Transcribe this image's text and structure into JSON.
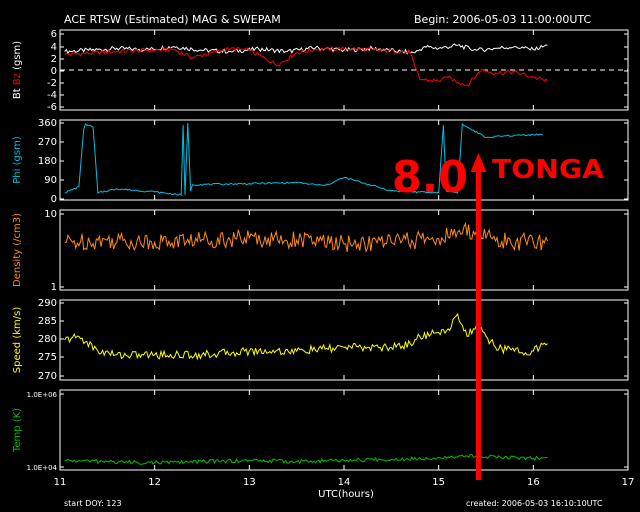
{
  "header": {
    "title": "ACE RTSW (Estimated) MAG & SWEPAM",
    "begin": "Begin: 2006-05-03 11:00:00UTC"
  },
  "footer": {
    "start_doy": "start DOY: 123",
    "created": "created: 2006-05-03 16:10:10UTC",
    "xlabel": "UTC(hours)"
  },
  "annotation": {
    "magnitude": "8.0",
    "place": "TONGA",
    "color": "#ff0000",
    "x_hour": 15.42
  },
  "colors": {
    "bt": "#ffffff",
    "bz": "#ff0000",
    "phi": "#00c0e0",
    "density": "#ff8c1a",
    "speed": "#ffff00",
    "temp": "#00c000"
  },
  "chart_data": {
    "type": "line",
    "xlim": [
      11,
      17
    ],
    "x_ticks": [
      "11",
      "12",
      "13",
      "14",
      "15",
      "16",
      "17"
    ],
    "panels": [
      {
        "name": "mag",
        "ylabel_parts": [
          "Bt",
          "Bz",
          "(gsm)"
        ],
        "ylim": [
          -6,
          6
        ],
        "ticks": [
          "6",
          "4",
          "2",
          "0",
          "-2",
          "-4",
          "-6"
        ],
        "zero_line": true,
        "series": [
          {
            "name": "Bt",
            "color": "#ffffff",
            "x": [
              11.05,
              11.3,
              11.6,
              11.9,
              12.2,
              12.5,
              12.8,
              13.1,
              13.4,
              13.7,
              14.0,
              14.3,
              14.6,
              14.75,
              14.85,
              15.0,
              15.2,
              15.4,
              15.6,
              15.8,
              16.0,
              16.15
            ],
            "y": [
              3.0,
              3.2,
              3.5,
              3.3,
              3.8,
              3.2,
              3.0,
              3.4,
              3.0,
              3.6,
              3.2,
              3.5,
              3.0,
              2.8,
              3.8,
              3.5,
              4.0,
              3.2,
              3.5,
              3.8,
              3.3,
              4.0
            ]
          },
          {
            "name": "Bz",
            "color": "#ff0000",
            "x": [
              11.05,
              11.3,
              11.6,
              11.9,
              12.2,
              12.4,
              12.6,
              12.8,
              13.0,
              13.3,
              13.5,
              13.7,
              14.0,
              14.3,
              14.6,
              14.7,
              14.75,
              14.8,
              15.0,
              15.1,
              15.3,
              15.45,
              15.6,
              15.8,
              16.0,
              16.15
            ],
            "y": [
              2.5,
              2.7,
              3.0,
              3.2,
              3.3,
              2.0,
              2.8,
              3.5,
              3.2,
              0.8,
              2.8,
              3.3,
              3.5,
              3.3,
              3.0,
              2.8,
              0.5,
              -1.5,
              -1.8,
              -1.2,
              -2.5,
              0.0,
              -0.5,
              -0.3,
              -1.2,
              -1.8
            ]
          }
        ]
      },
      {
        "name": "phi",
        "ylabel_parts": [
          "Phi",
          "(gsm)"
        ],
        "ylim": [
          0,
          360
        ],
        "ticks": [
          "360",
          "270",
          "180",
          "90",
          "0"
        ],
        "series": [
          {
            "name": "Phi",
            "color": "#00c0e0",
            "x": [
              11.05,
              11.2,
              11.25,
              11.27,
              11.35,
              11.4,
              11.6,
              12.0,
              12.28,
              12.3,
              12.32,
              12.35,
              12.38,
              12.4,
              13.0,
              13.5,
              13.8,
              14.0,
              14.5,
              14.9,
              15.0,
              15.05,
              15.08,
              15.2,
              15.25,
              15.3,
              15.5,
              15.8,
              16.1
            ],
            "y": [
              20,
              50,
              330,
              355,
              340,
              20,
              40,
              25,
              10,
              350,
              10,
              360,
              30,
              60,
              65,
              70,
              55,
              95,
              30,
              22,
              22,
              350,
              30,
              20,
              355,
              340,
              290,
              300,
              305
            ]
          }
        ]
      },
      {
        "name": "density",
        "ylabel_parts": [
          "Density",
          "(/cm3)"
        ],
        "ylim": [
          1,
          10
        ],
        "log": true,
        "ticks": [
          "10",
          "1"
        ],
        "series": [
          {
            "name": "Density",
            "color": "#ff8c1a",
            "x": [
              11.05,
              11.5,
              12.0,
              12.5,
              13.0,
              13.5,
              14.0,
              14.5,
              15.0,
              15.2,
              15.4,
              15.6,
              16.0,
              16.15
            ],
            "y": [
              4.0,
              4.3,
              4.0,
              4.4,
              4.6,
              4.3,
              3.8,
              4.0,
              4.5,
              5.5,
              5.8,
              4.2,
              4.0,
              4.2
            ]
          }
        ]
      },
      {
        "name": "speed",
        "ylabel_parts": [
          "Speed",
          "(km/s)"
        ],
        "ylim": [
          270,
          290
        ],
        "ticks": [
          "290",
          "285",
          "280",
          "275",
          "270"
        ],
        "series": [
          {
            "name": "Speed",
            "color": "#ffff00",
            "x": [
              11.05,
              11.2,
              11.4,
              11.6,
              12.0,
              12.5,
              13.0,
              13.5,
              14.0,
              14.5,
              14.7,
              14.8,
              15.0,
              15.1,
              15.2,
              15.25,
              15.3,
              15.4,
              15.5,
              15.6,
              15.8,
              16.0,
              16.15
            ],
            "y": [
              280,
              281,
              277,
              276,
              276,
              276,
              277,
              277,
              278,
              278,
              279,
              281,
              282,
              283,
              287,
              284,
              281,
              284,
              281,
              278,
              277,
              277,
              279
            ]
          }
        ]
      },
      {
        "name": "temp",
        "ylabel_parts": [
          "Temp",
          "(K)"
        ],
        "ylim": [
          10000,
          1000000
        ],
        "log": true,
        "ticks": [
          "1.0E+06",
          "1.0E+04"
        ],
        "series": [
          {
            "name": "Temp",
            "color": "#00c000",
            "x": [
              11.05,
              11.5,
              12.0,
              12.5,
              13.0,
              13.5,
              14.0,
              14.5,
              15.0,
              15.3,
              15.6,
              16.0,
              16.15
            ],
            "y": [
              15000,
              14000,
              13000,
              14000,
              15000,
              14000,
              15000,
              16000,
              18000,
              20000,
              19000,
              17000,
              18000
            ]
          }
        ]
      }
    ]
  }
}
